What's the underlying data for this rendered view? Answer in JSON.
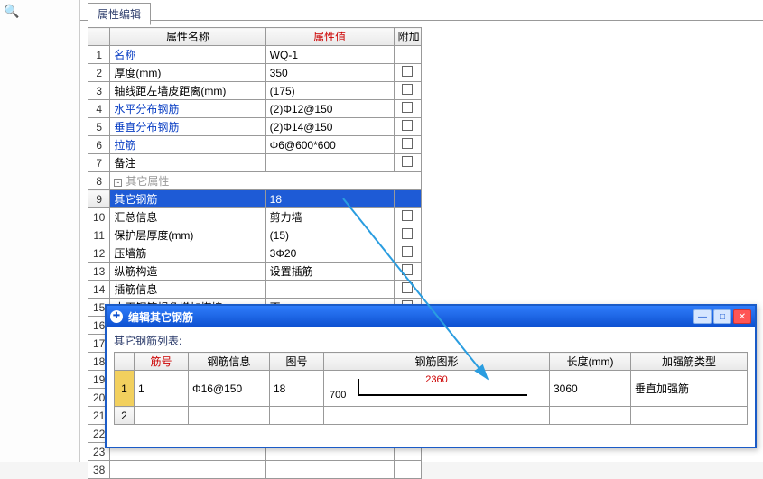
{
  "tab": {
    "label": "属性编辑"
  },
  "header": {
    "name": "属性名称",
    "value": "属性值",
    "extra": "附加"
  },
  "rows": [
    {
      "n": "1",
      "label": "名称",
      "value": "WQ-1",
      "blue": true,
      "chk": false
    },
    {
      "n": "2",
      "label": "厚度(mm)",
      "value": "350",
      "blue": false,
      "chk": true
    },
    {
      "n": "3",
      "label": "轴线距左墙皮距离(mm)",
      "value": "(175)",
      "blue": false,
      "chk": true
    },
    {
      "n": "4",
      "label": "水平分布钢筋",
      "value": "(2)Φ12@150",
      "blue": true,
      "chk": true
    },
    {
      "n": "5",
      "label": "垂直分布钢筋",
      "value": "(2)Φ14@150",
      "blue": true,
      "chk": true
    },
    {
      "n": "6",
      "label": "拉筋",
      "value": "Φ6@600*600",
      "blue": true,
      "chk": true
    },
    {
      "n": "7",
      "label": "备注",
      "value": "",
      "blue": false,
      "chk": true
    },
    {
      "n": "8",
      "label": "其它属性",
      "group": true
    },
    {
      "n": "9",
      "label": "其它钢筋",
      "value": "18",
      "indent": true,
      "selected": true
    },
    {
      "n": "10",
      "label": "汇总信息",
      "value": "剪力墙",
      "indent": true,
      "chk": true
    },
    {
      "n": "11",
      "label": "保护层厚度(mm)",
      "value": "(15)",
      "indent": true,
      "chk": true
    },
    {
      "n": "12",
      "label": "压墙筋",
      "value": "3Φ20",
      "indent": true,
      "chk": true
    },
    {
      "n": "13",
      "label": "纵筋构造",
      "value": "设置插筋",
      "indent": true,
      "chk": true
    },
    {
      "n": "14",
      "label": "插筋信息",
      "value": "",
      "indent": true,
      "chk": true
    },
    {
      "n": "15",
      "label": "水平钢筋拐角增加搭接",
      "value": "否",
      "indent": true,
      "chk": true
    },
    {
      "n": "16",
      "label": "",
      "value": ""
    },
    {
      "n": "17",
      "label": "",
      "value": ""
    },
    {
      "n": "18",
      "label": "",
      "value": ""
    },
    {
      "n": "19",
      "label": "",
      "value": ""
    },
    {
      "n": "20",
      "label": "",
      "value": ""
    },
    {
      "n": "21",
      "label": "",
      "value": ""
    },
    {
      "n": "22",
      "label": "",
      "value": ""
    },
    {
      "n": "23",
      "label": "",
      "value": ""
    },
    {
      "n": "38",
      "label": "",
      "value": ""
    }
  ],
  "dialog": {
    "title": "编辑其它钢筋",
    "list_label": "其它钢筋列表:",
    "header": {
      "num": "筋号",
      "info": "钢筋信息",
      "shape_no": "图号",
      "shape": "钢筋图形",
      "length": "长度(mm)",
      "type": "加强筋类型"
    },
    "rows": [
      {
        "rn": "1",
        "num": "1",
        "info": "Φ16@150",
        "shape_no": "18",
        "left_dim": "700",
        "top_dim": "2360",
        "length": "3060",
        "type": "垂直加强筋"
      },
      {
        "rn": "2"
      }
    ]
  }
}
